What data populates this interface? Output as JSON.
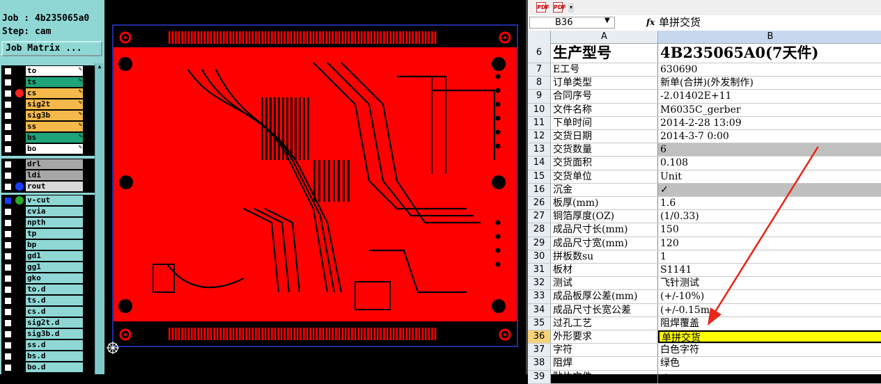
{
  "cam": {
    "job_label": "Job : 4b235065a0",
    "step_label": "Step: cam",
    "job_matrix_button": "Job Matrix ...",
    "group_board": [
      {
        "name": "to",
        "color": "#ffffff",
        "dot": null
      },
      {
        "name": "ts",
        "color": "#1fa37a",
        "dot": null
      },
      {
        "name": "cs",
        "color": "#f5b94b",
        "dot": "#ff2020"
      },
      {
        "name": "sig2t",
        "color": "#f5b94b",
        "dot": null
      },
      {
        "name": "sig3b",
        "color": "#f5b94b",
        "dot": null
      },
      {
        "name": "ss",
        "color": "#f5b94b",
        "dot": null
      },
      {
        "name": "bs",
        "color": "#1fa37a",
        "dot": null
      },
      {
        "name": "bo",
        "color": "#ffffff",
        "dot": null
      }
    ],
    "group_drill": [
      {
        "name": "drl",
        "color": "#a7a7a7",
        "dot": null
      },
      {
        "name": "ldi",
        "color": "#a7a7a7",
        "dot": null
      },
      {
        "name": "rout",
        "color": "#d9d9d9",
        "dot": "#1a3cff"
      }
    ],
    "group_misc": [
      {
        "name": "v-cut",
        "color": "#8fd7d5",
        "dot": "#2ea82e"
      },
      {
        "name": "cvia",
        "color": "#8fd7d5",
        "dot": null
      },
      {
        "name": "npth",
        "color": "#8fd7d5",
        "dot": null
      },
      {
        "name": "tp",
        "color": "#8fd7d5",
        "dot": null
      },
      {
        "name": "bp",
        "color": "#8fd7d5",
        "dot": null
      },
      {
        "name": "gd1",
        "color": "#8fd7d5",
        "dot": null
      },
      {
        "name": "gg1",
        "color": "#8fd7d5",
        "dot": null
      },
      {
        "name": "gko",
        "color": "#8fd7d5",
        "dot": null
      },
      {
        "name": "to.d",
        "color": "#8fd7d5",
        "dot": null
      },
      {
        "name": "ts.d",
        "color": "#8fd7d5",
        "dot": null
      },
      {
        "name": "cs.d",
        "color": "#8fd7d5",
        "dot": null
      },
      {
        "name": "sig2t.d",
        "color": "#8fd7d5",
        "dot": null
      },
      {
        "name": "sig3b.d",
        "color": "#8fd7d5",
        "dot": null
      },
      {
        "name": "ss.d",
        "color": "#8fd7d5",
        "dot": null
      },
      {
        "name": "bs.d",
        "color": "#8fd7d5",
        "dot": null
      },
      {
        "name": "bo.d",
        "color": "#8fd7d5",
        "dot": null
      }
    ]
  },
  "excel": {
    "cell_ref": "B36",
    "fx": "fx",
    "formula": "单拼交货",
    "col_a": "A",
    "col_b": "B",
    "rows": [
      {
        "n": "6",
        "a": "生产型号",
        "b": "4B235065A0(7天件)",
        "style": "big"
      },
      {
        "n": "7",
        "a": "E工号",
        "b": "630690",
        "style": ""
      },
      {
        "n": "8",
        "a": "订单类型",
        "b": "新单(合拼)(外发制作)",
        "style": ""
      },
      {
        "n": "9",
        "a": "合同序号",
        "b": "-2.01402E+11",
        "style": ""
      },
      {
        "n": "10",
        "a": "文件名称",
        "b": "M6035C_gerber",
        "style": ""
      },
      {
        "n": "11",
        "a": "下单时间",
        "b": "2014-2-28 13:09",
        "style": ""
      },
      {
        "n": "12",
        "a": "交货日期",
        "b": "2014-3-7 0:00",
        "style": ""
      },
      {
        "n": "13",
        "a": "交货数量",
        "b": "6",
        "style": "grey"
      },
      {
        "n": "14",
        "a": "交货面积",
        "b": "0.108",
        "style": ""
      },
      {
        "n": "15",
        "a": "交货单位",
        "b": "Unit",
        "style": ""
      },
      {
        "n": "16",
        "a": "沉金",
        "b": "✓",
        "style": "grey"
      },
      {
        "n": "26",
        "a": "板厚(mm)",
        "b": "1.6",
        "style": ""
      },
      {
        "n": "27",
        "a": "铜箔厚度(OZ)",
        "b": "(1/0.33)",
        "style": ""
      },
      {
        "n": "28",
        "a": "成品尺寸长(mm)",
        "b": "150",
        "style": ""
      },
      {
        "n": "29",
        "a": "成品尺寸宽(mm)",
        "b": "120",
        "style": ""
      },
      {
        "n": "30",
        "a": "拼板数su",
        "b": "1",
        "style": ""
      },
      {
        "n": "31",
        "a": "板材",
        "b": "S1141",
        "style": ""
      },
      {
        "n": "32",
        "a": "测试",
        "b": "飞针测试",
        "style": ""
      },
      {
        "n": "33",
        "a": "成品板厚公差(mm)",
        "b": "(+/-10%)",
        "style": ""
      },
      {
        "n": "34",
        "a": "成品尺寸长宽公差",
        "b": "(+/-0.15m",
        "style": ""
      },
      {
        "n": "35",
        "a": "过孔工艺",
        "b": "阻焊覆盖",
        "style": ""
      },
      {
        "n": "36",
        "a": "外形要求",
        "b": "单拼交货",
        "style": "sel"
      },
      {
        "n": "37",
        "a": "字符",
        "b": "白色字符",
        "style": ""
      },
      {
        "n": "38",
        "a": "阻焊",
        "b": "绿色",
        "style": ""
      },
      {
        "n": "39",
        "a": "贴片文件",
        "b": "✓",
        "style": ""
      }
    ]
  },
  "colors": {
    "panel": "#8fd7d5",
    "copper": "#ff0000",
    "outline": "#2d3bd8",
    "highlight": "#ffff00",
    "arrow": "#e8281c"
  }
}
